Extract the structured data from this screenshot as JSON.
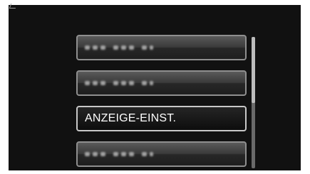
{
  "menu": {
    "items": [
      {
        "label": "",
        "blurred": true
      },
      {
        "label": "",
        "blurred": true
      },
      {
        "label": "ANZEIGE-EINST.",
        "blurred": false,
        "selected": true
      },
      {
        "label": "",
        "blurred": true
      }
    ]
  },
  "scrollbar": {
    "position_fraction": 0.0,
    "visible_fraction": 0.5
  },
  "colors": {
    "screen_background": "#111111",
    "item_border": "#8f8f8f",
    "text": "#ffffff"
  }
}
